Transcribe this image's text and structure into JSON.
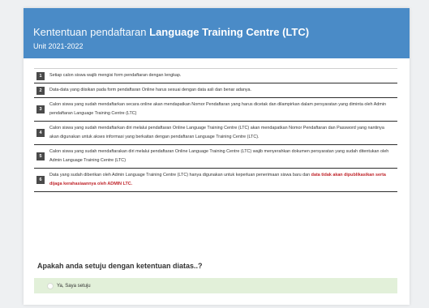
{
  "header": {
    "title_light": "Kententuan pendaftaran",
    "title_bold": "Language Training Centre (LTC)",
    "subtitle": "Unit 2021-2022"
  },
  "terms": [
    {
      "num": "1",
      "text": "Setiap calon siswa wajib mengisi form pendaftaran dengan lengkap.",
      "highlight": ""
    },
    {
      "num": "2",
      "text": "Data-data yang diisikan pada form pendaftaran Online harus sesuai dengan data asli dan benar adanya.",
      "highlight": ""
    },
    {
      "num": "3",
      "text": "Calon siswa yang sudah mendaftarkan secara online akan mendapatkan Nomor Pendaftaran yang harus dicetak dan dilampirkan dalam persyaratan yang diminta oleh Admin pendaftaran Language Training Centre (LTC)",
      "highlight": ""
    },
    {
      "num": "4",
      "text": "Calon siswa yang sudah mendaftarkan diri melalui pendaftaran Online Language Training Centre (LTC) akan mendapatkan Nomor Pendaftaran dan Password yang nantinya akan digunakan untuk akses informasi yang berkaitan dengan pendaftaran Language Training Centre (LTC).",
      "highlight": ""
    },
    {
      "num": "5",
      "text": "Calon siswa yang sudah mendaftarakan diri melalui pendaftaran Online Language Training Centre (LTC) wajib menyerahkan dokumen persyaratan yang sudah ditentukan oleh Admin Language Training Centre (LTC)",
      "highlight": ""
    },
    {
      "num": "6",
      "text": "Data yang sudah diberikan oleh Admin Language Training Centre (LTC) hanya digunakan untuk keperluan penerimaan siswa baru dan ",
      "highlight": "data tidak akan dipublikasikan serta dijaga kerahasiaannya oleh ADMIN LTC."
    }
  ],
  "question": "Apakah anda setuju dengan ketentuan diatas..?",
  "answer": {
    "label": "Ya, Saya setuju"
  },
  "colors": {
    "header": "#4a8bc7",
    "highlight": "#c0272d",
    "answer_bg": "#e2f0d9"
  }
}
